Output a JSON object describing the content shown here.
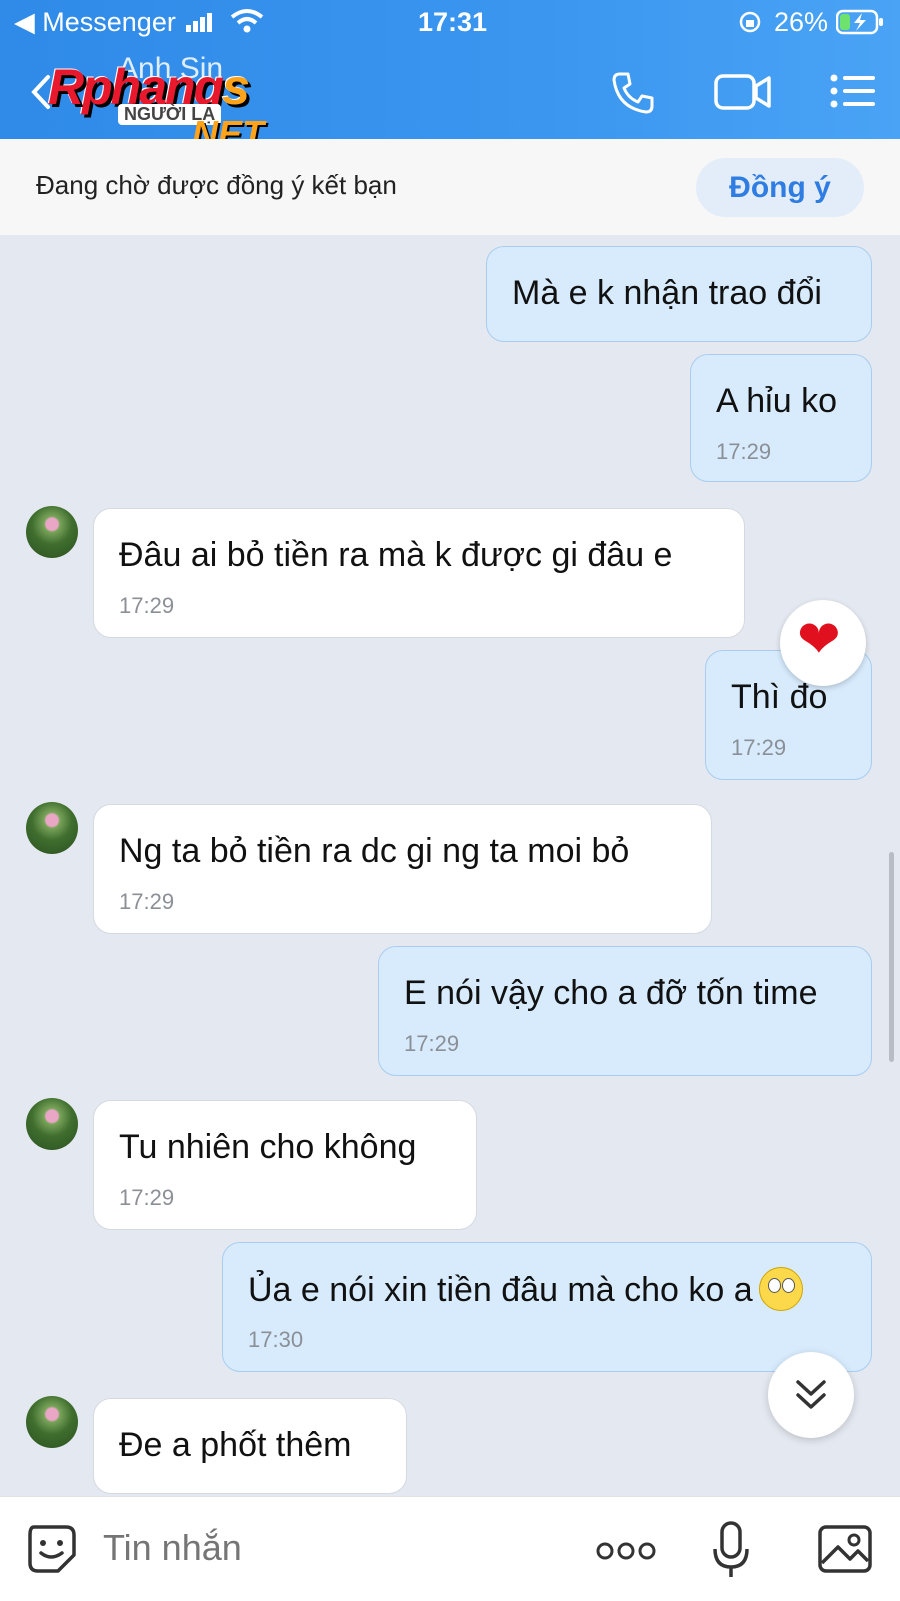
{
  "status_bar": {
    "back_app": "◀ Messenger",
    "time": "17:31",
    "battery": "26%"
  },
  "header": {
    "contact_name": "Anh Sin",
    "icons": [
      "back-icon",
      "phone-icon",
      "video-call-icon",
      "menu-icon"
    ]
  },
  "watermark": {
    "brand": "Rphangs",
    "sub": "NGƯỜI LẠ",
    "tld": ".NET"
  },
  "friend_bar": {
    "status": "Đang chờ được đồng ý kết bạn",
    "accept_label": "Đồng ý"
  },
  "messages": [
    {
      "direction": "out",
      "text": "Mà e k nhận trao đổi",
      "time": ""
    },
    {
      "direction": "out",
      "text": "A hỉu ko",
      "time": "17:29"
    },
    {
      "direction": "in",
      "text": "Đâu ai bỏ tiền ra mà k được gi đâu e",
      "time": "17:29"
    },
    {
      "direction": "out",
      "text": "Thì đo",
      "time": "17:29",
      "reaction": "❤"
    },
    {
      "direction": "in",
      "text": "Ng ta bỏ tiền ra dc gi ng ta moi bỏ",
      "time": "17:29"
    },
    {
      "direction": "out",
      "text": "E nói vậy cho a đỡ tốn time",
      "time": "17:29"
    },
    {
      "direction": "in",
      "text": "Tu nhiên cho không",
      "time": "17:29"
    },
    {
      "direction": "out",
      "text": "Ủa e nói xin tiền đâu mà cho ko a",
      "time": "17:30",
      "emoji": "smiley"
    },
    {
      "direction": "in",
      "text": "Đe a phốt thêm",
      "time": ""
    }
  ],
  "composer": {
    "placeholder": "Tin nhắn",
    "icons": [
      "sticker-icon",
      "more-icon",
      "microphone-icon",
      "image-icon"
    ]
  },
  "colors": {
    "header": "#3a96ef",
    "outgoing_bubble": "#d7ebfd",
    "incoming_bubble": "#ffffff",
    "background": "#e4e8f0",
    "accent": "#2f7de2"
  }
}
